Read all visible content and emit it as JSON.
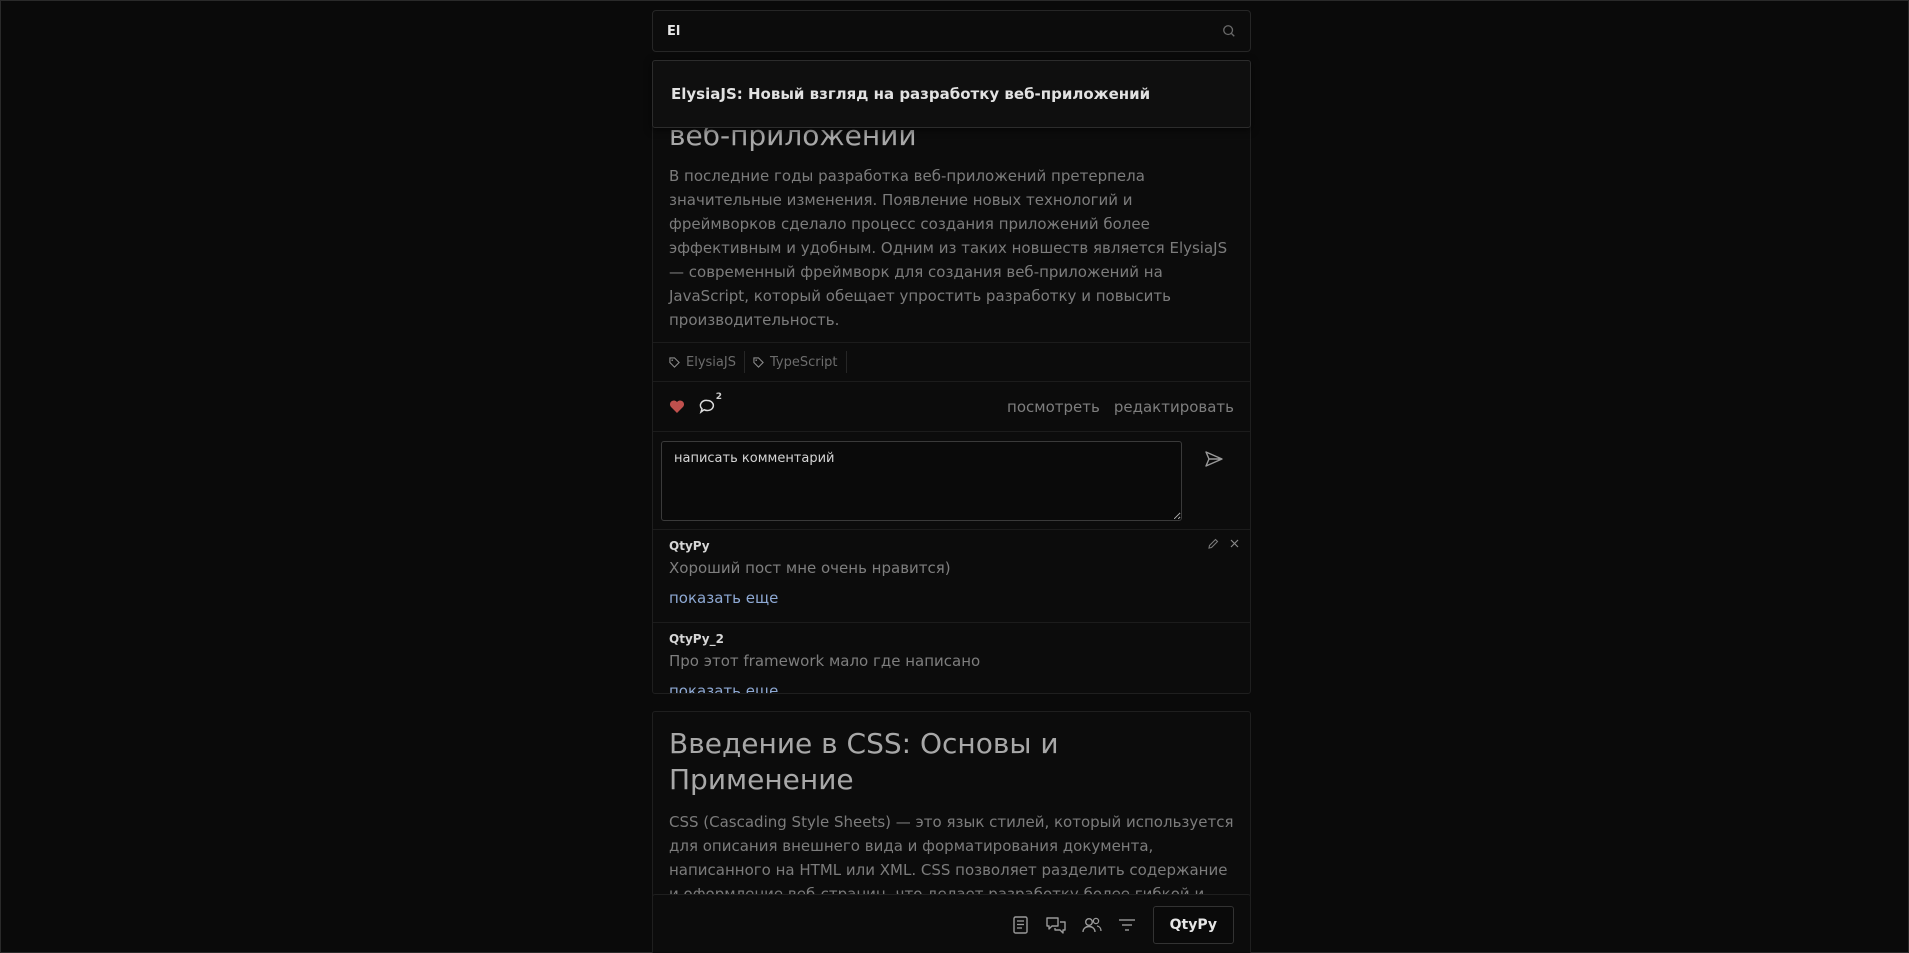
{
  "search": {
    "value": "El",
    "suggestion": "ElysiaJS: Новый взгляд на разработку веб-приложений"
  },
  "post1": {
    "title_visible": "веб-приложений",
    "body": "В последние годы разработка веб-приложений претерпела значительные изменения. Появление новых технологий и фреймворков сделало процесс создания приложений более эффективным и удобным. Одним из таких новшеств является ElysiaJS — современный фреймворк для создания веб-приложений на JavaScript, который обещает упростить разработку и повысить производительность.",
    "tags": [
      "ElysiaJS",
      "TypeScript"
    ],
    "liked": true,
    "comment_count": "2",
    "view_label": "посмотреть",
    "edit_label": "редактировать",
    "comment_placeholder": "написать комментарий",
    "comments": [
      {
        "author": "QtyPy",
        "text": "Хороший пост мне очень нравится)",
        "more": "показать еще"
      },
      {
        "author": "QtyPy_2",
        "text": "Про этот framework мало где написано",
        "more": "показать еще"
      }
    ]
  },
  "post2": {
    "title": "Введение в CSS: Основы и Применение",
    "body": "CSS (Cascading Style Sheets) — это язык стилей, который используется для описания внешнего вида и форматирования документа, написанного на HTML или XML. CSS позволяет разделить содержание и оформление веб-страниц, что делает разработку более гибкой и удобной."
  },
  "bottom_nav": {
    "user_label": "QtyPy",
    "icons": [
      "posts-icon",
      "chats-icon",
      "users-icon",
      "filter-icon"
    ]
  },
  "colors": {
    "background": "#0a0a0a",
    "heart": "#c0504d",
    "link": "#8ea9d4"
  }
}
